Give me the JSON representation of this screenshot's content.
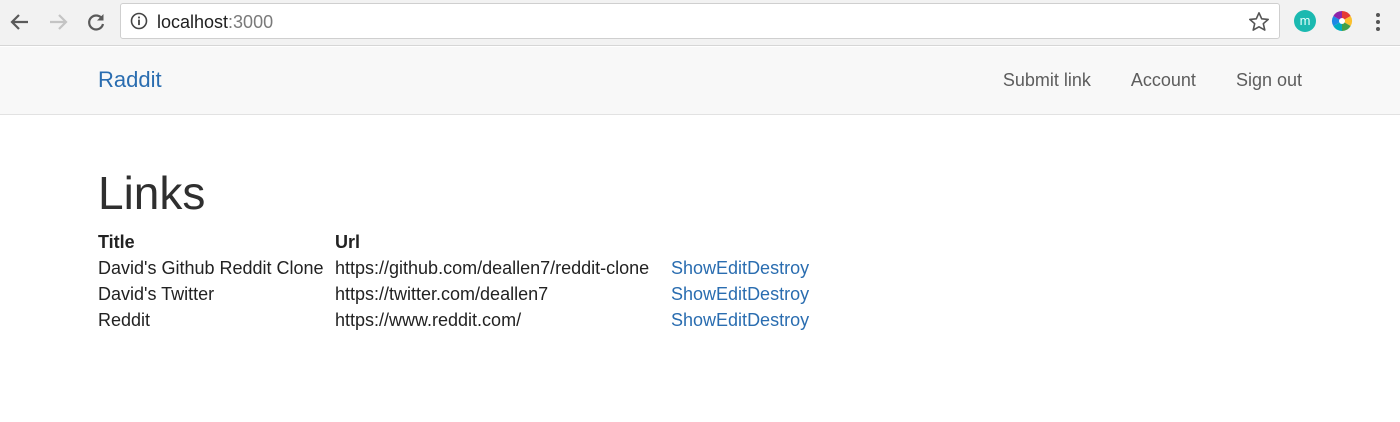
{
  "browser": {
    "url_host": "localhost",
    "url_port": ":3000",
    "extension_initial": "m"
  },
  "navbar": {
    "brand": "Raddit",
    "links": [
      "Submit link",
      "Account",
      "Sign out"
    ]
  },
  "page": {
    "title": "Links",
    "columns": [
      "Title",
      "Url",
      ""
    ],
    "rows": [
      {
        "title": "David's Github Reddit Clone",
        "url": "https://github.com/deallen7/reddit-clone",
        "show": "Show",
        "edit": "Edit",
        "destroy": "Destroy"
      },
      {
        "title": "David's Twitter",
        "url": "https://twitter.com/deallen7",
        "show": "Show",
        "edit": "Edit",
        "destroy": "Destroy"
      },
      {
        "title": "Reddit",
        "url": "https://www.reddit.com/",
        "show": "Show",
        "edit": "Edit",
        "destroy": "Destroy"
      }
    ]
  },
  "colors": {
    "link": "#2a6db0",
    "navbar_bg": "#f8f8f8",
    "chrome_bg": "#f2f2f2"
  }
}
